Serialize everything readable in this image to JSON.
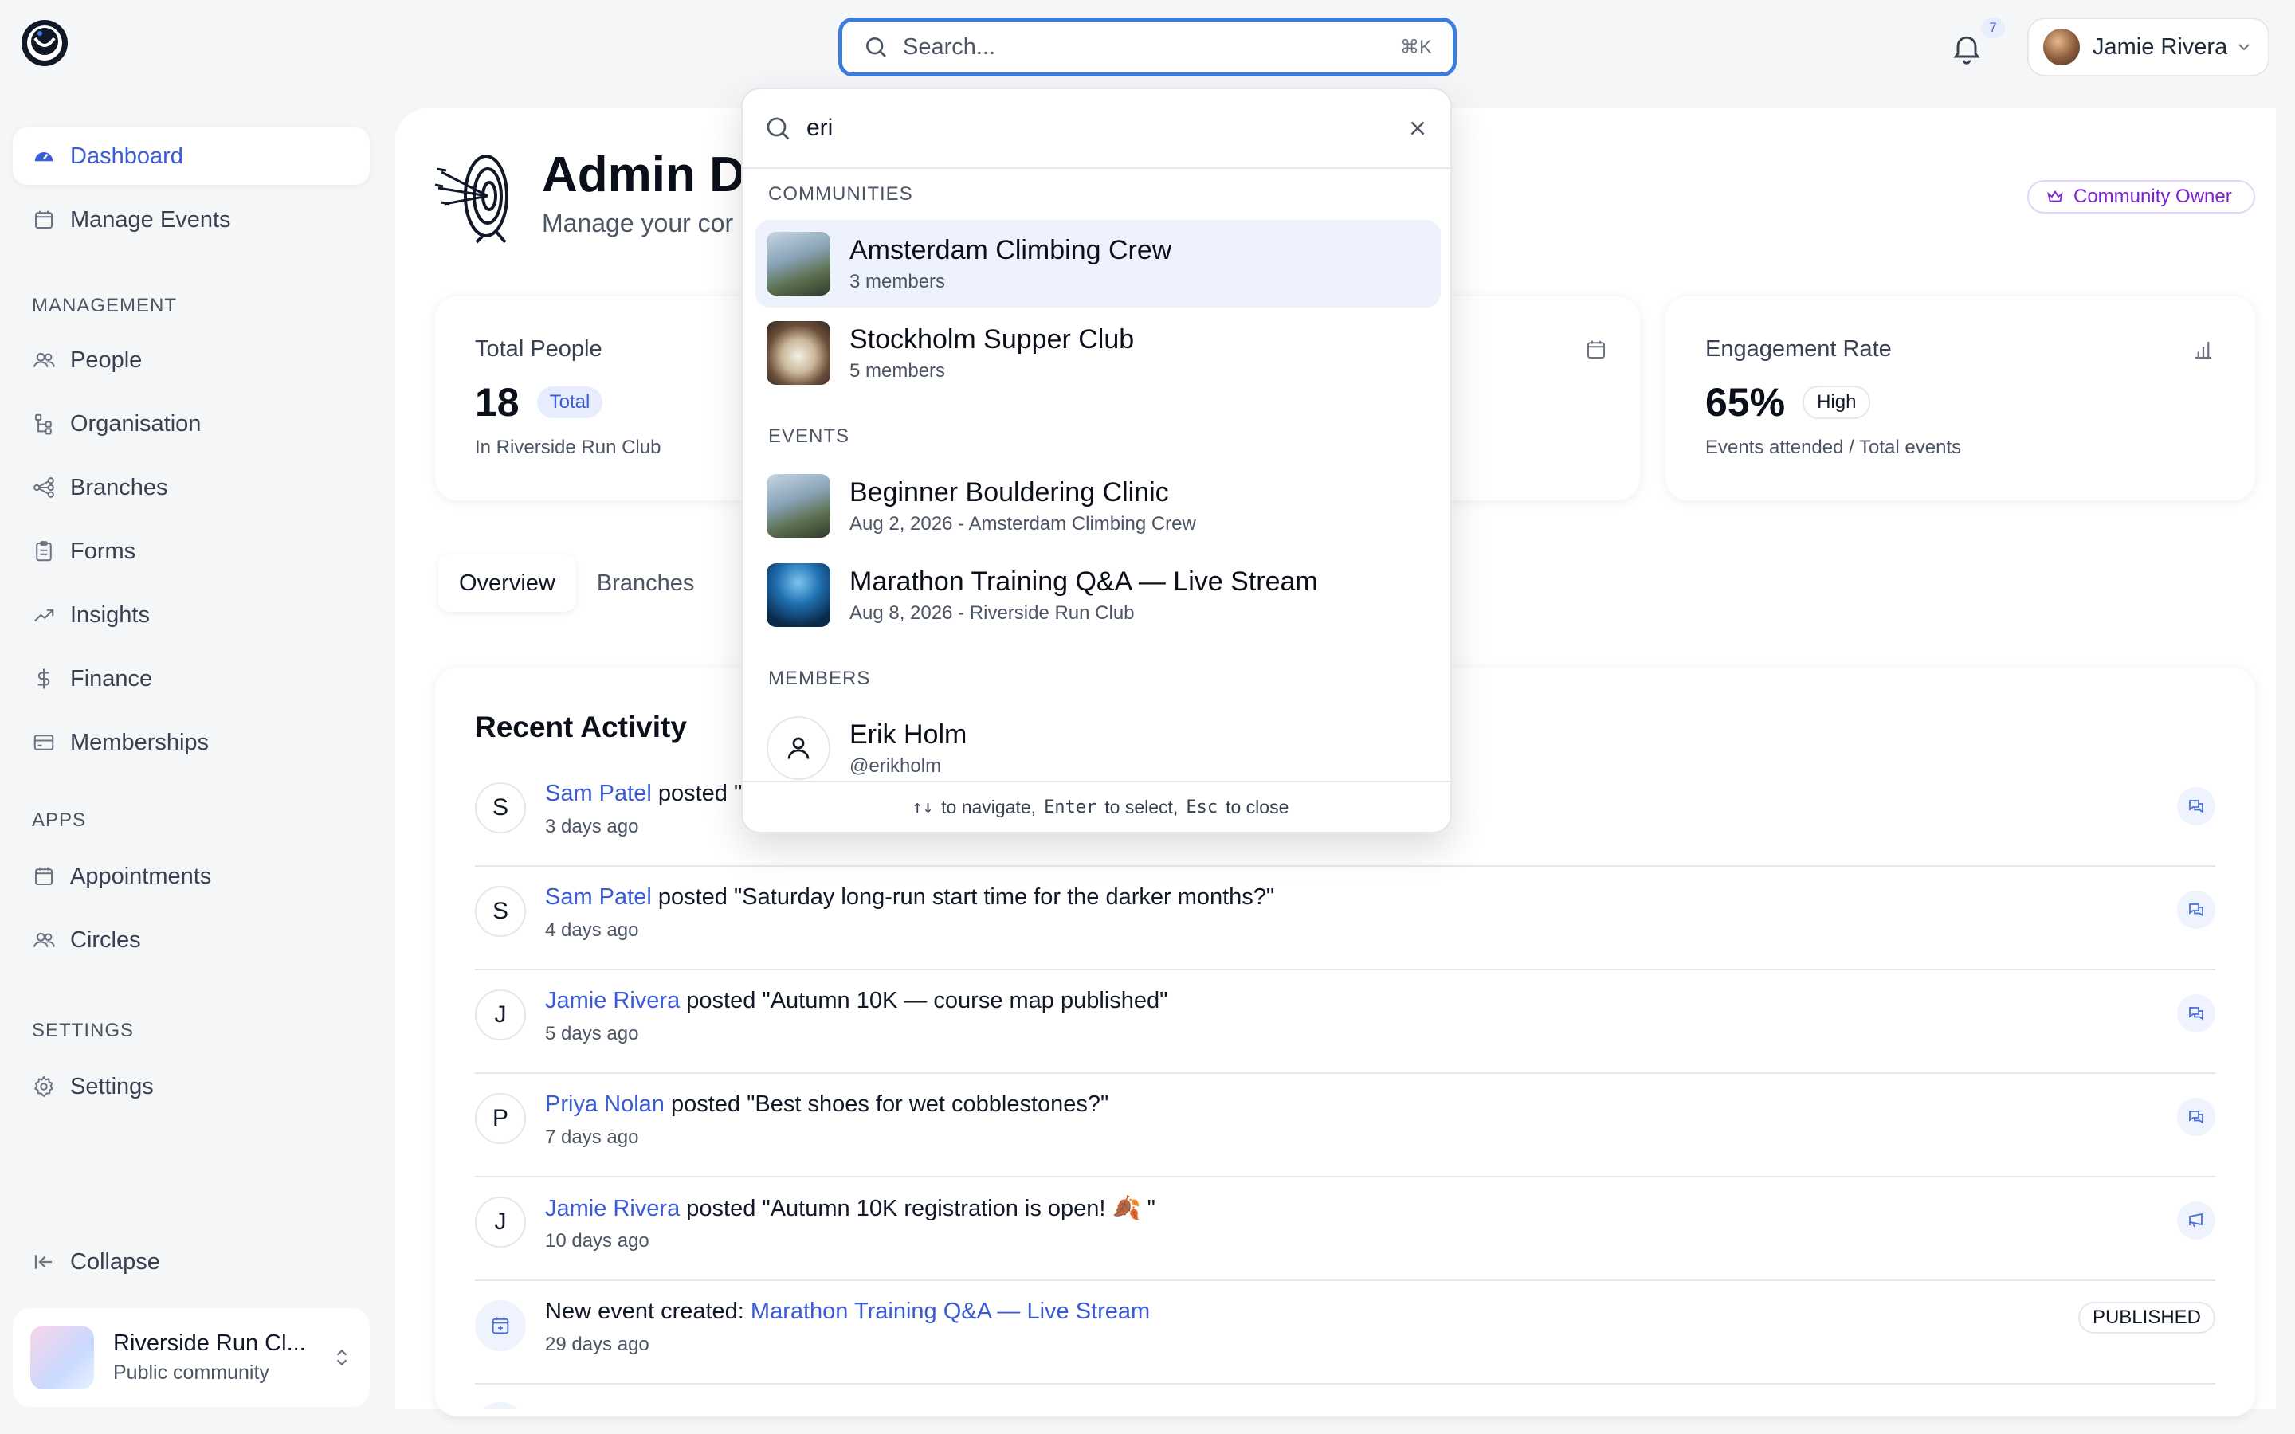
{
  "topbar": {
    "search_placeholder": "Search...",
    "search_shortcut": "⌘K",
    "notification_count": "7",
    "user_name": "Jamie Rivera"
  },
  "sidebar": {
    "top_items": [
      {
        "label": "Dashboard",
        "icon": "dashboard-icon",
        "active": true
      },
      {
        "label": "Manage Events",
        "icon": "calendar-icon"
      }
    ],
    "sections": [
      {
        "title": "MANAGEMENT",
        "items": [
          {
            "label": "People",
            "icon": "people-icon"
          },
          {
            "label": "Organisation",
            "icon": "org-icon"
          },
          {
            "label": "Branches",
            "icon": "branches-icon"
          },
          {
            "label": "Forms",
            "icon": "forms-icon"
          },
          {
            "label": "Insights",
            "icon": "trend-icon"
          },
          {
            "label": "Finance",
            "icon": "dollar-icon"
          },
          {
            "label": "Memberships",
            "icon": "card-icon"
          }
        ]
      },
      {
        "title": "APPS",
        "items": [
          {
            "label": "Appointments",
            "icon": "calendar-icon"
          },
          {
            "label": "Circles",
            "icon": "people-icon"
          }
        ]
      },
      {
        "title": "SETTINGS",
        "items": [
          {
            "label": "Settings",
            "icon": "gear-icon"
          }
        ]
      }
    ],
    "collapse_label": "Collapse",
    "community": {
      "name": "Riverside Run Cl...",
      "type": "Public community"
    }
  },
  "header": {
    "title": "Admin Da",
    "subtitle": "Manage your cor",
    "role_badge": "Community Owner"
  },
  "stats": [
    {
      "label": "Total People",
      "value": "18",
      "badge": "Total",
      "sub": "In Riverside Run Club"
    },
    {
      "label": "Engagement Rate",
      "value": "65%",
      "badge": "High",
      "sub": "Events attended / Total events"
    }
  ],
  "tabs": [
    {
      "label": "Overview",
      "active": true
    },
    {
      "label": "Branches"
    }
  ],
  "recent_activity": {
    "title": "Recent Activity",
    "items": [
      {
        "initial": "S",
        "who": "Sam Patel",
        "verb": "posted",
        "text": " \"",
        "time": "3 days ago",
        "icon": "comment-icon"
      },
      {
        "initial": "S",
        "who": "Sam Patel",
        "verb": "posted",
        "text": " \"Saturday long-run start time for the darker months?\"",
        "time": "4 days ago",
        "icon": "comment-icon"
      },
      {
        "initial": "J",
        "who": "Jamie Rivera",
        "verb": "posted",
        "text": " \"Autumn 10K — course map published\"",
        "time": "5 days ago",
        "icon": "comment-icon"
      },
      {
        "initial": "P",
        "who": "Priya Nolan",
        "verb": "posted",
        "text": " \"Best shoes for wet cobblestones?\"",
        "time": "7 days ago",
        "icon": "comment-icon"
      },
      {
        "initial": "J",
        "who": "Jamie Rivera",
        "verb": "posted",
        "text": " \"Autumn 10K registration is open! 🍂 \"",
        "time": "10 days ago",
        "icon": "megaphone-icon"
      },
      {
        "event_prefix": "New event created: ",
        "event_name": "Marathon Training Q&A — Live Stream",
        "time": "29 days ago",
        "badge": "PUBLISHED"
      }
    ]
  },
  "search_dropdown": {
    "query": "eri",
    "sections": {
      "communities": "COMMUNITIES",
      "events": "EVENTS",
      "members": "MEMBERS"
    },
    "communities": [
      {
        "title": "Amsterdam Climbing Crew",
        "sub": "3 members",
        "highlighted": true
      },
      {
        "title": "Stockholm Supper Club",
        "sub": "5 members"
      }
    ],
    "events": [
      {
        "title": "Beginner Bouldering Clinic",
        "sub": "Aug 2, 2026 - Amsterdam Climbing Crew"
      },
      {
        "title": "Marathon Training Q&A — Live Stream",
        "sub": "Aug 8, 2026 - Riverside Run Club"
      }
    ],
    "members": [
      {
        "title": "Erik Holm",
        "sub": "@erikholm"
      }
    ],
    "footer": {
      "nav_keys": "↑↓",
      "nav_text": "to navigate,",
      "select_key": "Enter",
      "select_text": "to select,",
      "close_key": "Esc",
      "close_text": "to close"
    }
  },
  "colors": {
    "accent": "#3b5bd6",
    "focus": "#3b7ddd",
    "owner": "#7e22ce"
  }
}
